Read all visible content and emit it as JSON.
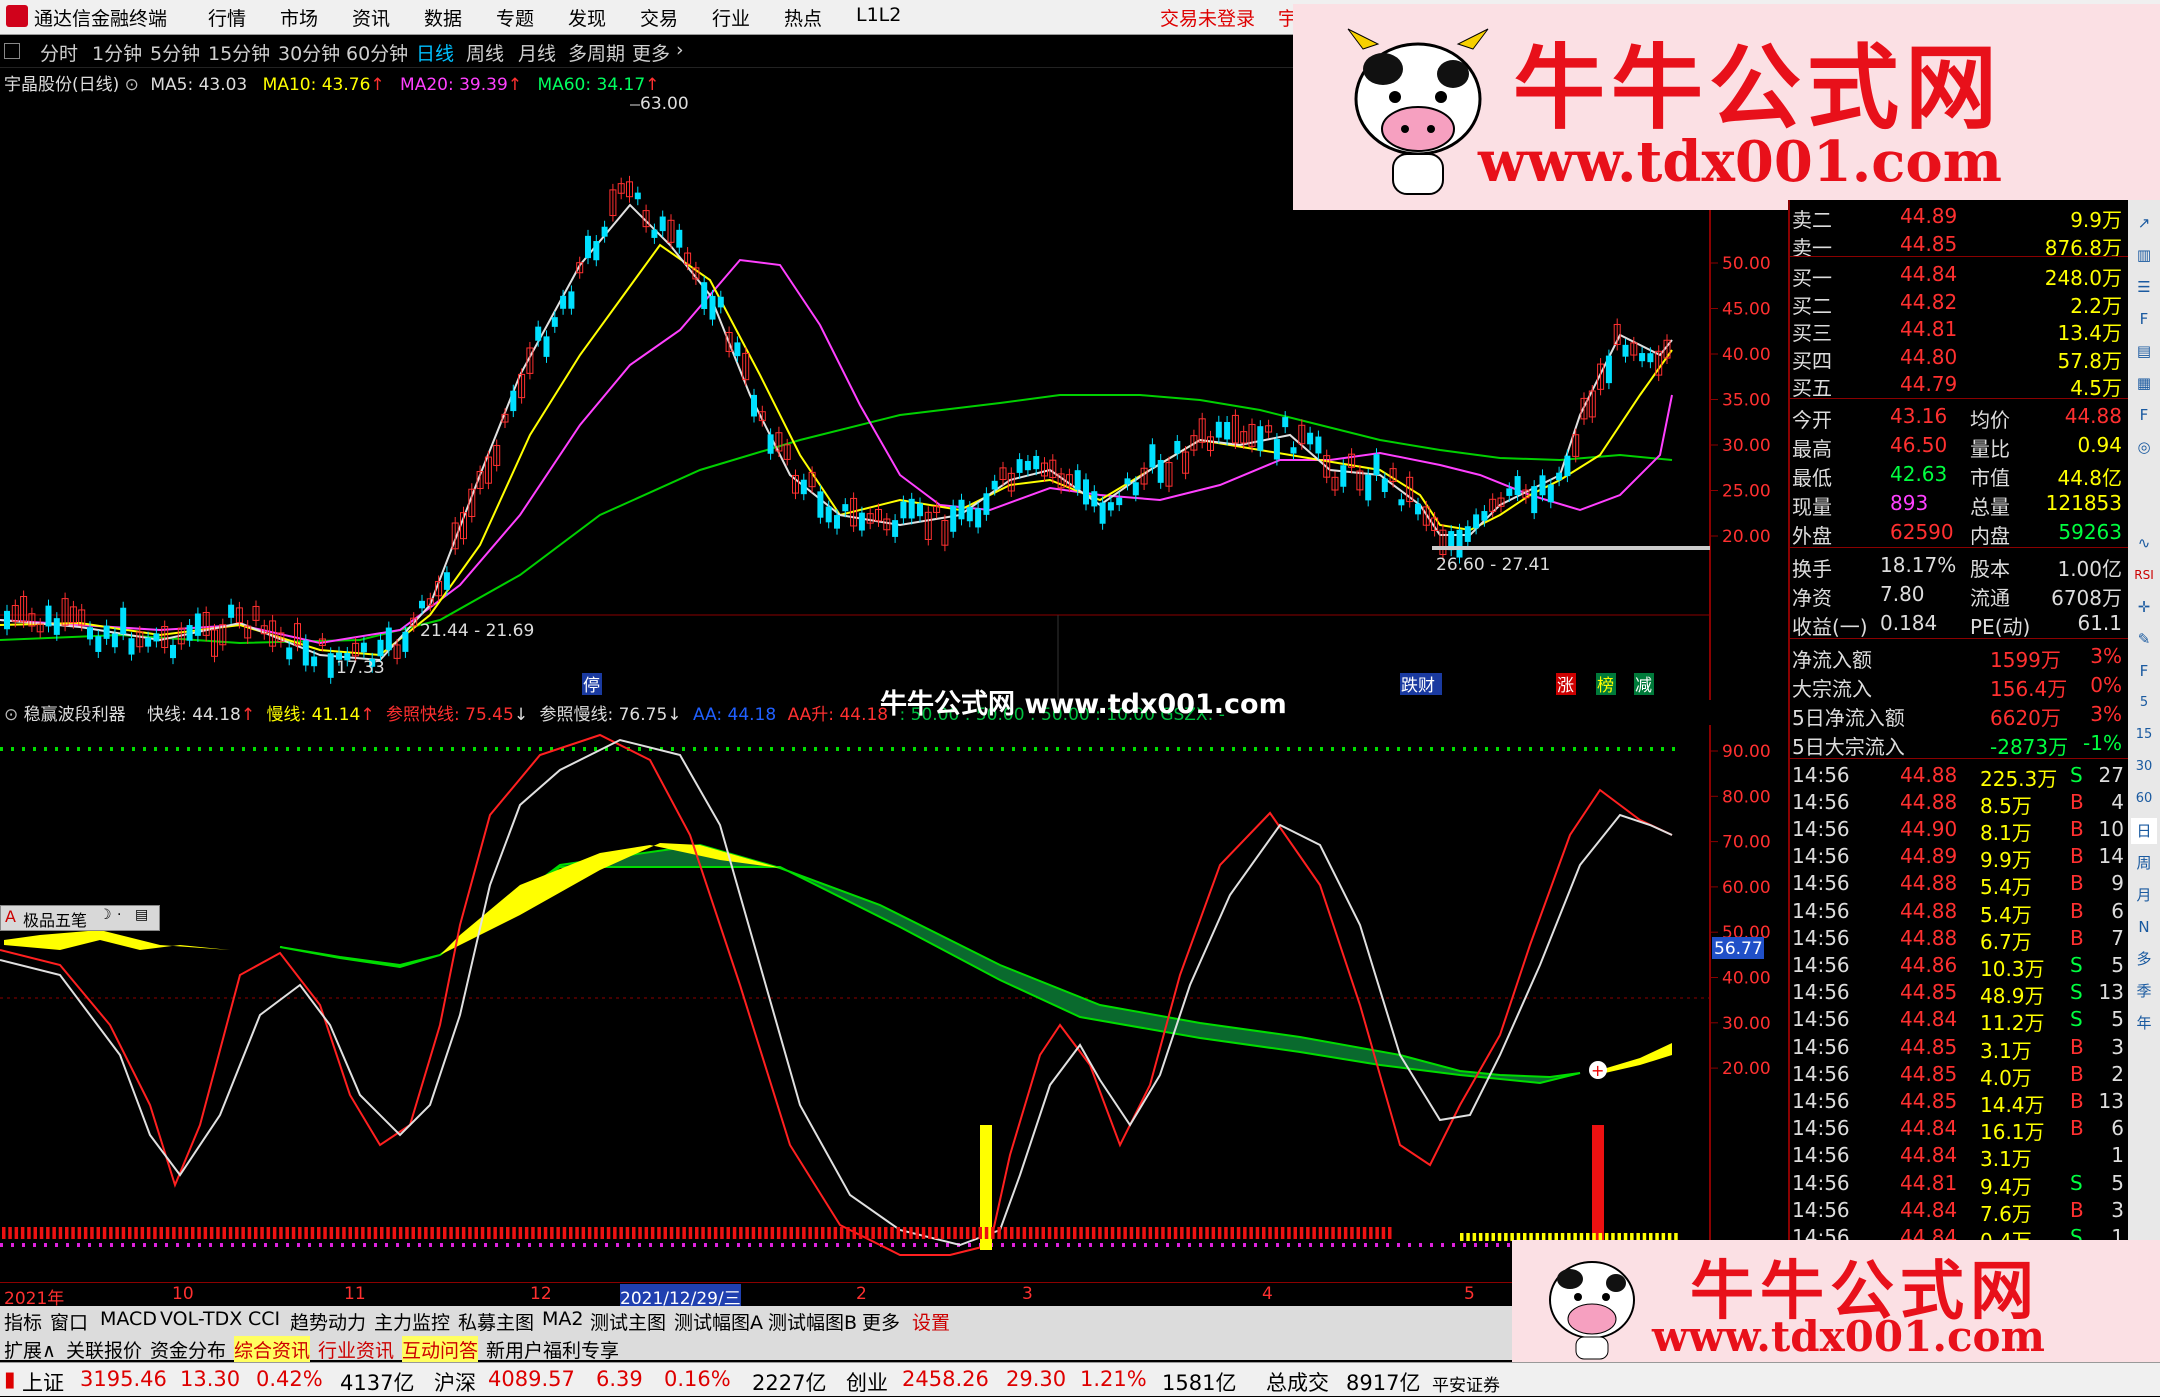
{
  "app": {
    "name": "通达信金融终端"
  },
  "menu": [
    "行情",
    "市场",
    "资讯",
    "数据",
    "专题",
    "发现",
    "交易",
    "行业",
    "热点",
    "L1L2"
  ],
  "menu_right": "交易未登录",
  "menu_right2": "宇",
  "periods": [
    "分时",
    "1分钟",
    "5分钟",
    "15分钟",
    "30分钟",
    "60分钟",
    "日线",
    "周线",
    "月线",
    "多周期",
    "更多"
  ],
  "active_period": "日线",
  "main_chart": {
    "stock": "宇晶股份(日线)",
    "ma5": "MA5: 43.03",
    "ma10": "MA10: 43.76",
    "ma20": "MA20: 39.39",
    "ma60": "MA60: 34.17",
    "peak_label": "63.00",
    "low_label": "17.33",
    "range1": "21.44 - 21.69",
    "range2": "26.60 - 27.41",
    "markers": [
      "停",
      "跌财",
      "涨",
      "榜",
      "减"
    ],
    "y_ticks": [
      "50.00",
      "45.00",
      "40.00",
      "35.00",
      "30.00",
      "25.00",
      "20.00"
    ]
  },
  "indicator": {
    "name": "稳赢波段利器",
    "fast": "快线: 44.18",
    "slow": "慢线: 41.14",
    "ref_fast": "参照快线: 75.45",
    "ref_slow": "参照慢线: 76.75",
    "aa": "AA: 44.18",
    "aa_up": "AA升: 44.18",
    "tail": ": 50.00 : 50.00 : 50.00 : 10.00 GSZX: -",
    "y_ticks": [
      "90.00",
      "80.00",
      "70.00",
      "60.00",
      "50.00",
      "40.00",
      "30.00",
      "20.00"
    ],
    "current_value": "56.77",
    "watermark": "牛牛公式网 www.tdx001.com"
  },
  "float_toolbar": "极品五笔",
  "quote": {
    "asks": [
      {
        "label": "卖二",
        "price": "44.89",
        "vol": "9.9万"
      },
      {
        "label": "卖一",
        "price": "44.85",
        "vol": "876.8万"
      }
    ],
    "bids": [
      {
        "label": "买一",
        "price": "44.84",
        "vol": "248.0万"
      },
      {
        "label": "买二",
        "price": "44.82",
        "vol": "2.2万"
      },
      {
        "label": "买三",
        "price": "44.81",
        "vol": "13.4万"
      },
      {
        "label": "买四",
        "price": "44.80",
        "vol": "57.8万"
      },
      {
        "label": "买五",
        "price": "44.79",
        "vol": "4.5万"
      }
    ],
    "stats": [
      {
        "l1": "今开",
        "v1": "43.16",
        "l2": "均价",
        "v2": "44.88"
      },
      {
        "l1": "最高",
        "v1": "46.50",
        "l2": "量比",
        "v2": "0.94"
      },
      {
        "l1": "最低",
        "v1": "42.63",
        "l2": "市值",
        "v2": "44.8亿"
      },
      {
        "l1": "现量",
        "v1": "893",
        "l2": "总量",
        "v2": "121853"
      },
      {
        "l1": "外盘",
        "v1": "62590",
        "l2": "内盘",
        "v2": "59263"
      }
    ],
    "stats2": [
      {
        "l1": "换手",
        "v1": "18.17%",
        "l2": "股本",
        "v2": "1.00亿"
      },
      {
        "l1": "净资",
        "v1": "7.80",
        "l2": "流通",
        "v2": "6708万"
      },
      {
        "l1": "收益(一)",
        "v1": "0.184",
        "l2": "PE(动)",
        "v2": "61.1"
      }
    ],
    "flows": [
      {
        "l": "净流入额",
        "v": "1599万",
        "p": "3%"
      },
      {
        "l": "大宗流入",
        "v": "156.4万",
        "p": "0%"
      },
      {
        "l": "5日净流入额",
        "v": "6620万",
        "p": "3%"
      },
      {
        "l": "5日大宗流入",
        "v": "-2873万",
        "p": "-1%"
      }
    ],
    "ticks": [
      {
        "t": "14:56",
        "p": "44.88",
        "v": "225.3万",
        "s": "S",
        "n": "27"
      },
      {
        "t": "14:56",
        "p": "44.88",
        "v": "8.5万",
        "s": "B",
        "n": "4"
      },
      {
        "t": "14:56",
        "p": "44.90",
        "v": "8.1万",
        "s": "B",
        "n": "10"
      },
      {
        "t": "14:56",
        "p": "44.89",
        "v": "9.9万",
        "s": "B",
        "n": "14"
      },
      {
        "t": "14:56",
        "p": "44.88",
        "v": "5.4万",
        "s": "B",
        "n": "9"
      },
      {
        "t": "14:56",
        "p": "44.88",
        "v": "5.4万",
        "s": "B",
        "n": "6"
      },
      {
        "t": "14:56",
        "p": "44.88",
        "v": "6.7万",
        "s": "B",
        "n": "7"
      },
      {
        "t": "14:56",
        "p": "44.86",
        "v": "10.3万",
        "s": "S",
        "n": "5"
      },
      {
        "t": "14:56",
        "p": "44.85",
        "v": "48.9万",
        "s": "S",
        "n": "13"
      },
      {
        "t": "14:56",
        "p": "44.84",
        "v": "11.2万",
        "s": "S",
        "n": "5"
      },
      {
        "t": "14:56",
        "p": "44.85",
        "v": "3.1万",
        "s": "B",
        "n": "3"
      },
      {
        "t": "14:56",
        "p": "44.85",
        "v": "4.0万",
        "s": "B",
        "n": "2"
      },
      {
        "t": "14:56",
        "p": "44.85",
        "v": "14.4万",
        "s": "B",
        "n": "13"
      },
      {
        "t": "14:56",
        "p": "44.84",
        "v": "16.1万",
        "s": "B",
        "n": "6"
      },
      {
        "t": "14:56",
        "p": "44.84",
        "v": "3.1万",
        "s": "",
        "n": "1"
      },
      {
        "t": "14:56",
        "p": "44.81",
        "v": "9.4万",
        "s": "S",
        "n": "5"
      },
      {
        "t": "14:56",
        "p": "44.84",
        "v": "7.6万",
        "s": "B",
        "n": "3"
      },
      {
        "t": "14:56",
        "p": "44.84",
        "v": "0.4万",
        "s": "S",
        "n": "1"
      }
    ]
  },
  "sidebar": [
    "RSI",
    "日",
    "周",
    "月",
    "N",
    "多",
    "季",
    "年"
  ],
  "time_axis": [
    "2021年",
    "10",
    "11",
    "12",
    "2021/12/29/三",
    "2",
    "3",
    "4",
    "5"
  ],
  "tabs1": [
    "指标",
    "窗口",
    "MACD",
    "VOL-TDX",
    "CCI",
    "趋势动力",
    "主力监控",
    "私募主图",
    "MA2",
    "测试主图",
    "测试幅图A",
    "测试幅图B",
    "更多",
    "设置"
  ],
  "tabs2": [
    "扩展∧",
    "关联报价",
    "资金分布",
    "综合资讯",
    "行业资讯",
    "互动问答",
    "新用户福利专享"
  ],
  "status": {
    "sh_name": "上证",
    "sh_val": "3195.46",
    "sh_chg": "13.30",
    "sh_pct": "0.42%",
    "sh_amt": "4137亿",
    "sz_name": "沪深",
    "sz_val": "4089.57",
    "sz_chg": "6.39",
    "sz_pct": "0.16%",
    "sz_amt": "2227亿",
    "cy_name": "创业",
    "cy_val": "2458.26",
    "cy_chg": "29.30",
    "cy_pct": "1.21%",
    "cy_amt": "1581亿",
    "tot_name": "总成交",
    "tot_amt": "8917亿",
    "broker": "平安证券"
  },
  "watermark": {
    "title": "牛牛公式网",
    "url": "www.tdx001.com"
  }
}
